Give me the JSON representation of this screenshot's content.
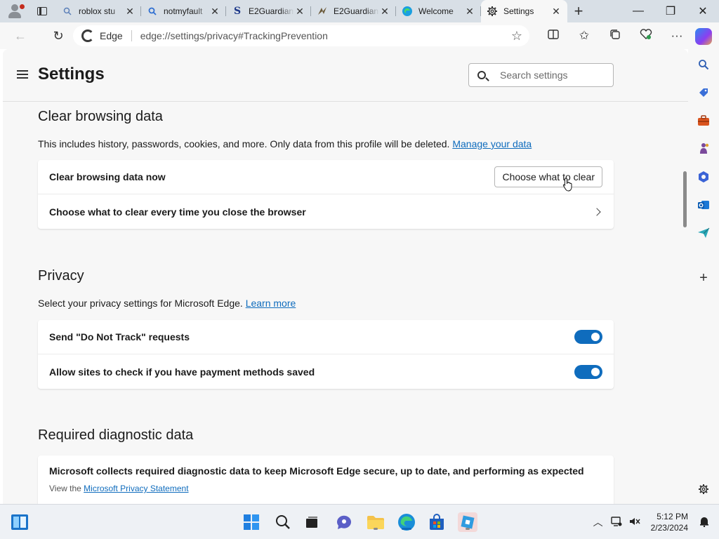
{
  "browser": {
    "tabs": [
      {
        "title": "roblox stu",
        "icon": "search-icon",
        "active": false
      },
      {
        "title": "notmyfault",
        "icon": "search-icon",
        "active": false
      },
      {
        "title": "E2Guardian",
        "icon": "s-logo-icon",
        "active": false
      },
      {
        "title": "E2Guardian",
        "icon": "bird-icon",
        "active": false
      },
      {
        "title": "Welcome",
        "icon": "edge-icon",
        "active": false
      },
      {
        "title": "Settings",
        "icon": "gear-icon",
        "active": true
      }
    ],
    "address": {
      "label": "Edge",
      "url": "edge://settings/privacy#TrackingPrevention"
    }
  },
  "settings": {
    "title": "Settings",
    "search_placeholder": "Search settings",
    "clear_browsing": {
      "title": "Clear browsing data",
      "description": "This includes history, passwords, cookies, and more. Only data from this profile will be deleted.",
      "link": "Manage your data",
      "rows": [
        {
          "label": "Clear browsing data now",
          "button": "Choose what to clear"
        },
        {
          "label": "Choose what to clear every time you close the browser"
        }
      ]
    },
    "privacy": {
      "title": "Privacy",
      "description": "Select your privacy settings for Microsoft Edge.",
      "link": "Learn more",
      "rows": [
        {
          "label": "Send \"Do Not Track\" requests",
          "enabled": true
        },
        {
          "label": "Allow sites to check if you have payment methods saved",
          "enabled": true
        }
      ]
    },
    "diagnostic": {
      "title": "Required diagnostic data",
      "main": "Microsoft collects required diagnostic data to keep Microsoft Edge secure, up to date, and performing as expected",
      "sub_prefix": "View the",
      "sub_link": "Microsoft Privacy Statement"
    }
  },
  "taskbar": {
    "time": "5:12 PM",
    "date": "2/23/2024"
  },
  "colors": {
    "accent": "#0f6cbd",
    "page_bg": "#f7f7f7",
    "tabstrip_bg": "#d8dfe6"
  }
}
